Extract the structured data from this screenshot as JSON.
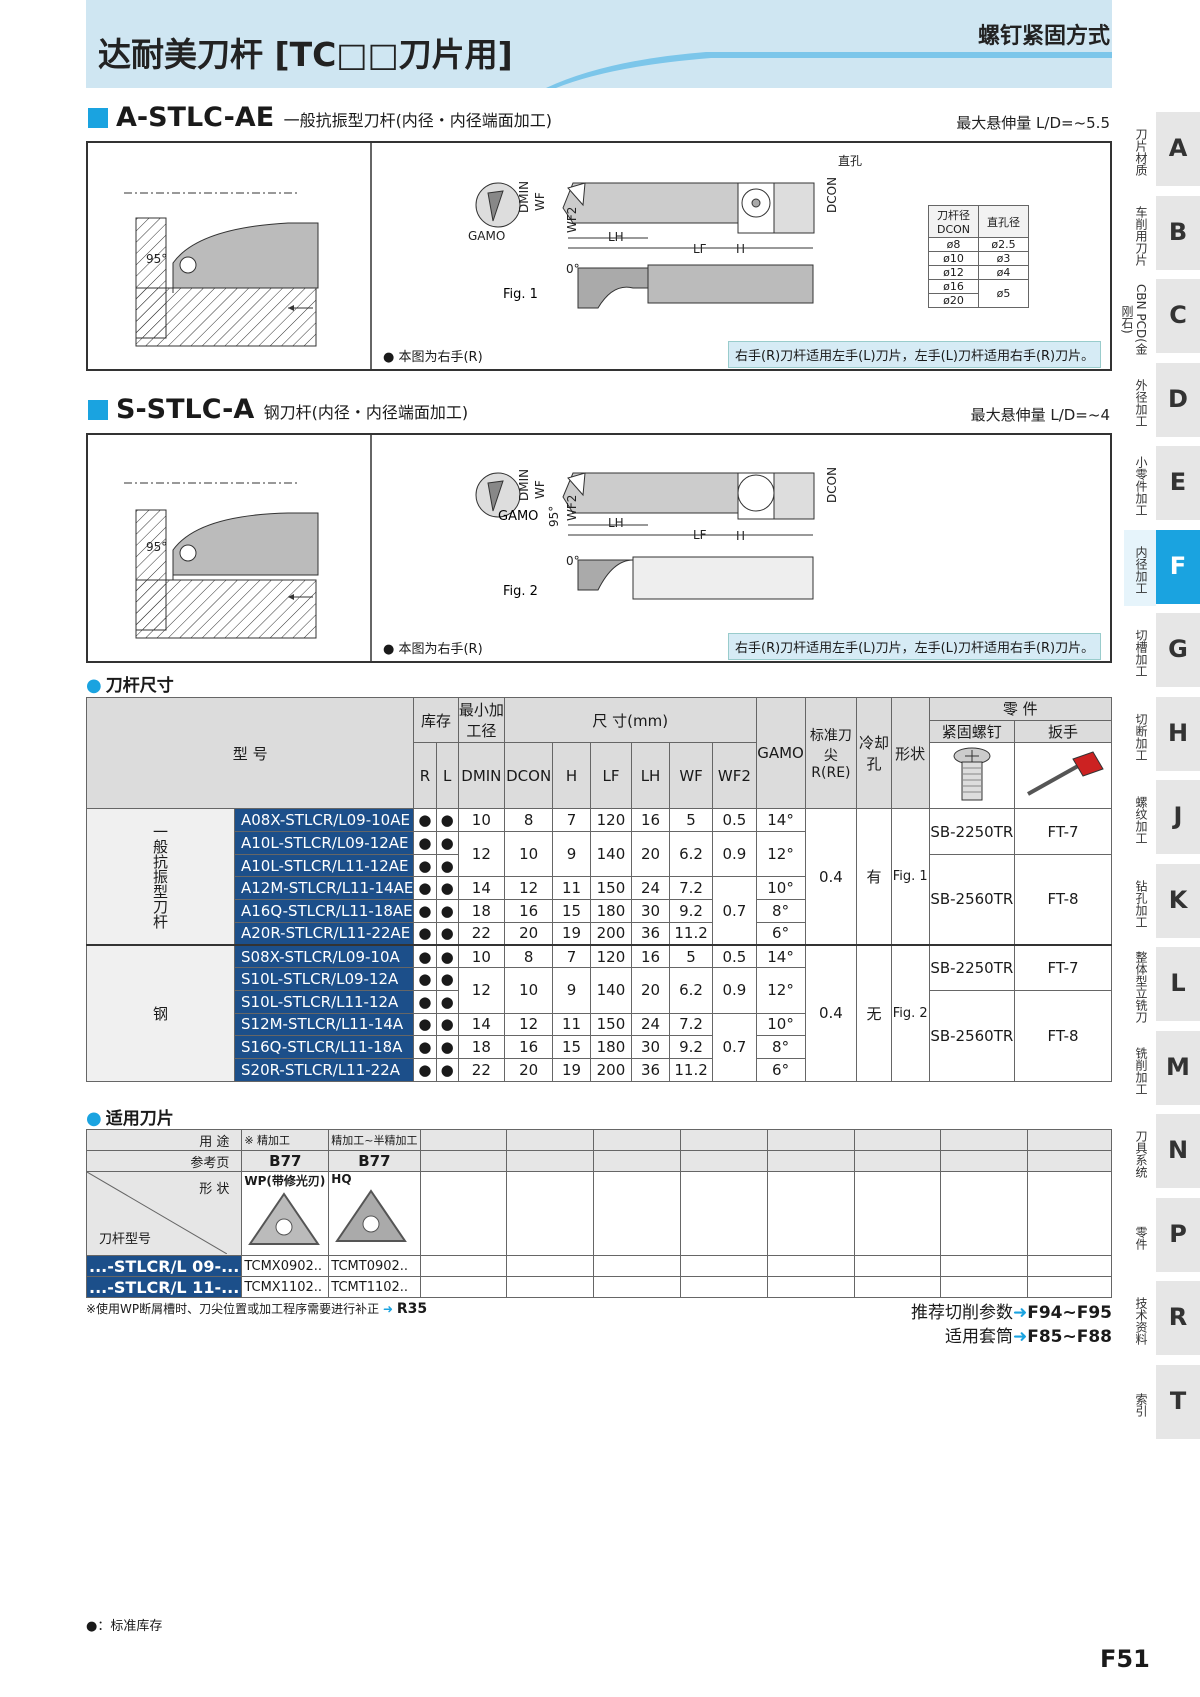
{
  "header": {
    "title": "达耐美刀杆 [TC□□刀片用]",
    "subtitle": "螺钉紧固方式"
  },
  "section1": {
    "code": "A-STLC-AE",
    "desc": "一般抗振型刀杆(内径・内径端面加工)",
    "max_ld": "最大悬伸量 L/D=~5.5",
    "fig_label": "Fig. 1",
    "note_left": "● 本图为右手(R)",
    "note_right": "右手(R)刀杆适用左手(L)刀片，左手(L)刀杆适用右手(R)刀片。",
    "hole_label": "直孔",
    "angle_label": "95°",
    "zero_label": "0°",
    "dims": {
      "dmin": "DMIN",
      "wf": "WF",
      "wf2": "WF2",
      "lh": "LH",
      "lf": "LF",
      "h": "H",
      "dcon": "DCON",
      "gamo": "GAMO"
    },
    "hole_table": {
      "headers": [
        "刀杆径 DCON",
        "直孔径"
      ],
      "rows": [
        [
          "ø8",
          "ø2.5"
        ],
        [
          "ø10",
          "ø3"
        ],
        [
          "ø12",
          "ø4"
        ],
        [
          "ø16",
          "ø5"
        ],
        [
          "ø20",
          ""
        ]
      ]
    }
  },
  "section2": {
    "code": "S-STLC-A",
    "desc": "钢刀杆(内径・内径端面加工)",
    "max_ld": "最大悬伸量 L/D=~4",
    "fig_label": "Fig. 2",
    "note_left": "● 本图为右手(R)",
    "note_right": "右手(R)刀杆适用左手(L)刀片，左手(L)刀杆适用右手(R)刀片。",
    "angle_label": "95°",
    "zero_label": "0°"
  },
  "main_table": {
    "heading": "刀杆尺寸",
    "h_model": "型 号",
    "h_stock": "库存",
    "h_min": "最小加工径",
    "h_dims": "尺 寸(mm)",
    "h_gamo": "GAMO",
    "h_re": "标准刀尖R(RE)",
    "h_cool": "冷却孔",
    "h_shape": "形状",
    "h_parts": "零 件",
    "h_screw": "紧固螺钉",
    "h_wrench": "扳手",
    "sub": [
      "R",
      "L",
      "DMIN",
      "DCON",
      "H",
      "LF",
      "LH",
      "WF",
      "WF2"
    ],
    "cat1": "一般抗振型刀杆",
    "cat2": "钢",
    "rows1": [
      {
        "m": "A08X-STLCR/L09-10AE",
        "dmin": "10",
        "dcon": "8",
        "h": "7",
        "lf": "120",
        "lh": "16",
        "wf": "5",
        "wf2": "0.5",
        "gamo": "14°"
      },
      {
        "m": "A10L-STLCR/L09-12AE",
        "dmin": "12",
        "dcon": "10",
        "h": "9",
        "lf": "140",
        "lh": "20",
        "wf": "6.2",
        "wf2": "0.9",
        "gamo": "12°"
      },
      {
        "m": "A10L-STLCR/L11-12AE"
      },
      {
        "m": "A12M-STLCR/L11-14AE",
        "dmin": "14",
        "dcon": "12",
        "h": "11",
        "lf": "150",
        "lh": "24",
        "wf": "7.2",
        "wf2": "0.7",
        "gamo": "10°"
      },
      {
        "m": "A16Q-STLCR/L11-18AE",
        "dmin": "18",
        "dcon": "16",
        "h": "15",
        "lf": "180",
        "lh": "30",
        "wf": "9.2",
        "gamo": "8°"
      },
      {
        "m": "A20R-STLCR/L11-22AE",
        "dmin": "22",
        "dcon": "20",
        "h": "19",
        "lf": "200",
        "lh": "36",
        "wf": "11.2",
        "gamo": "6°"
      }
    ],
    "rows2": [
      {
        "m": "S08X-STLCR/L09-10A",
        "dmin": "10",
        "dcon": "8",
        "h": "7",
        "lf": "120",
        "lh": "16",
        "wf": "5",
        "wf2": "0.5",
        "gamo": "14°"
      },
      {
        "m": "S10L-STLCR/L09-12A",
        "dmin": "12",
        "dcon": "10",
        "h": "9",
        "lf": "140",
        "lh": "20",
        "wf": "6.2",
        "wf2": "0.9",
        "gamo": "12°"
      },
      {
        "m": "S10L-STLCR/L11-12A"
      },
      {
        "m": "S12M-STLCR/L11-14A",
        "dmin": "14",
        "dcon": "12",
        "h": "11",
        "lf": "150",
        "lh": "24",
        "wf": "7.2",
        "wf2": "0.7",
        "gamo": "10°"
      },
      {
        "m": "S16Q-STLCR/L11-18A",
        "dmin": "18",
        "dcon": "16",
        "h": "15",
        "lf": "180",
        "lh": "30",
        "wf": "9.2",
        "gamo": "8°"
      },
      {
        "m": "S20R-STLCR/L11-22A",
        "dmin": "22",
        "dcon": "20",
        "h": "19",
        "lf": "200",
        "lh": "36",
        "wf": "11.2",
        "gamo": "6°"
      }
    ],
    "stock_dot": "●",
    "re": "0.4",
    "cool1": "有",
    "cool2": "无",
    "shape1": "Fig. 1",
    "shape2": "Fig. 2",
    "screw_a": "SB-2250TR",
    "screw_b": "SB-2560TR",
    "wrench_a": "FT-7",
    "wrench_b": "FT-8"
  },
  "insert_table": {
    "heading": "适用刀片",
    "r_use": "用 途",
    "r_page": "参考页",
    "r_shape": "形 状",
    "r_holder": "刀杆型号",
    "c1_use": "※ 精加工",
    "c2_use": "精加工~半精加工",
    "c1_page": "B77",
    "c2_page": "B77",
    "c1_shape": "WP(带修光刃)",
    "c2_shape": "HQ",
    "m1": "...-STLCR/L 09-...",
    "m2": "...-STLCR/L 11-...",
    "v11": "TCMX0902..",
    "v12": "TCMT0902..",
    "v21": "TCMX1102..",
    "v22": "TCMT1102.."
  },
  "footer": {
    "note": "※使用WP断屑槽时、刀尖位置或加工程序需要进行补正",
    "note_ref": "R35",
    "rec1": "推荐切削参数",
    "rec1_ref": "F94~F95",
    "rec2": "适用套筒",
    "rec2_ref": "F85~F88",
    "legend": "●：标准库存",
    "page": "F51"
  },
  "sidebar": [
    {
      "letter": "A",
      "label": "刀片材质"
    },
    {
      "letter": "B",
      "label": "车削用刀片"
    },
    {
      "letter": "C",
      "label": "CBN PCD(金刚石)"
    },
    {
      "letter": "D",
      "label": "外径加工"
    },
    {
      "letter": "E",
      "label": "小零件加工"
    },
    {
      "letter": "F",
      "label": "内径加工",
      "active": true
    },
    {
      "letter": "G",
      "label": "切槽加工"
    },
    {
      "letter": "H",
      "label": "切断加工"
    },
    {
      "letter": "J",
      "label": "螺纹加工"
    },
    {
      "letter": "K",
      "label": "钻孔加工"
    },
    {
      "letter": "L",
      "label": "整体型立铣刀"
    },
    {
      "letter": "M",
      "label": "铣削加工"
    },
    {
      "letter": "N",
      "label": "刀具系统"
    },
    {
      "letter": "P",
      "label": "零件"
    },
    {
      "letter": "R",
      "label": "技术资料"
    },
    {
      "letter": "T",
      "label": "索引"
    }
  ],
  "colors": {
    "accent": "#1aa3e0",
    "header_bg": "#cfe6f2",
    "model_bg": "#1c4f8a"
  }
}
